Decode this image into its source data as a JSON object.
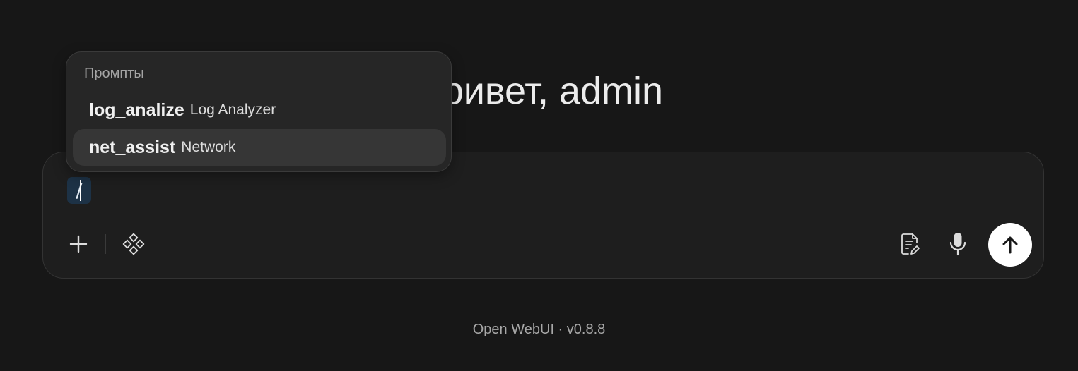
{
  "greeting": "Привет, admin",
  "composer": {
    "input_value": "/",
    "icons": {
      "plus": "plus-icon",
      "tools": "tools-icon",
      "note": "note-edit-icon",
      "mic": "microphone-icon",
      "send": "arrow-up-icon"
    }
  },
  "prompts_popover": {
    "header": "Промпты",
    "items": [
      {
        "command": "log_analize",
        "title": "Log Analyzer",
        "highlighted": false
      },
      {
        "command": "net_assist",
        "title": "Network",
        "highlighted": true
      }
    ]
  },
  "footer": "Open WebUI · v0.8.8",
  "colors": {
    "background": "#171717",
    "composer": "#1e1e1e",
    "popover": "#262626",
    "highlight": "#363636",
    "slash_token": "#1d3246",
    "send_button": "#ffffff"
  }
}
